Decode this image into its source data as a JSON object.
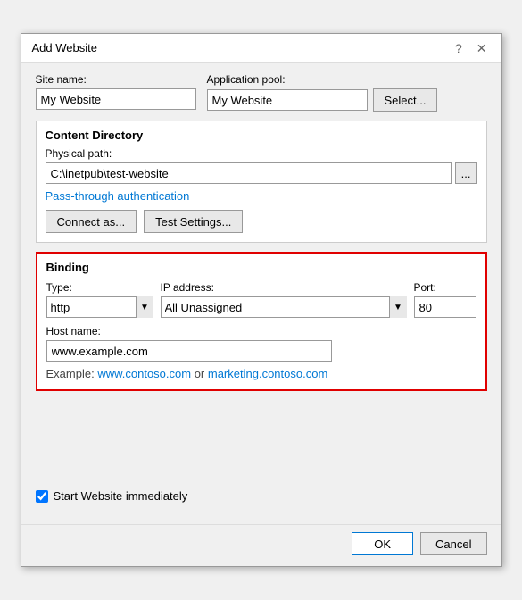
{
  "dialog": {
    "title": "Add Website",
    "help_icon": "?",
    "close_icon": "✕"
  },
  "form": {
    "site_name_label": "Site name:",
    "site_name_value": "My Website",
    "app_pool_label": "Application pool:",
    "app_pool_value": "My Website",
    "select_btn": "Select...",
    "content_directory_title": "Content Directory",
    "physical_path_label": "Physical path:",
    "physical_path_value": "C:\\inetpub\\test-website",
    "browse_btn": "...",
    "passthrough_label": "Pass-through authentication",
    "connect_as_btn": "Connect as...",
    "test_settings_btn": "Test Settings...",
    "binding_title": "Binding",
    "type_label": "Type:",
    "type_value": "http",
    "ip_label": "IP address:",
    "ip_value": "All Unassigned",
    "port_label": "Port:",
    "port_value": "80",
    "host_name_label": "Host name:",
    "host_name_value": "www.example.com",
    "example_text": "Example: ",
    "example_link1": "www.contoso.com",
    "example_or": " or ",
    "example_link2": "marketing.contoso.com",
    "start_website_label": "Start Website immediately",
    "ok_btn": "OK",
    "cancel_btn": "Cancel"
  },
  "colors": {
    "accent": "#0078d4",
    "binding_border": "#e00000"
  }
}
